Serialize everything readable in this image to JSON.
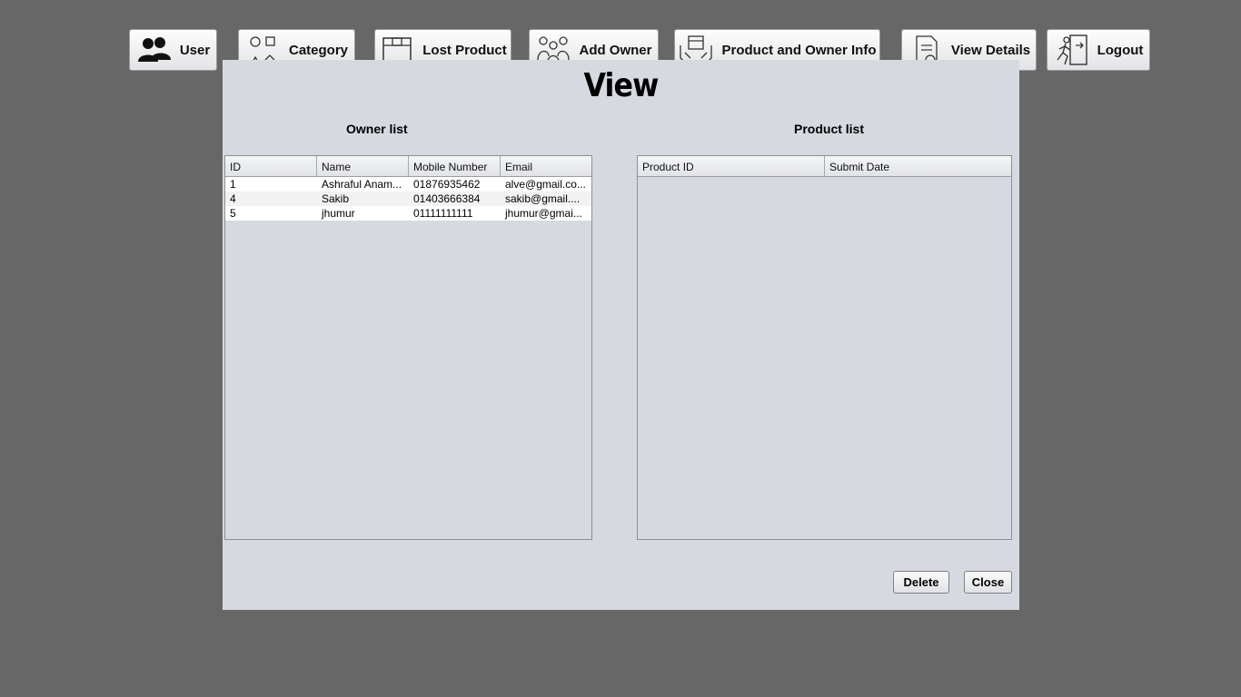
{
  "nav": [
    {
      "label": "User",
      "icon": "users-icon"
    },
    {
      "label": "Category",
      "icon": "shapes-icon"
    },
    {
      "label": "Lost Product",
      "icon": "box-icon"
    },
    {
      "label": "Add Owner",
      "icon": "people-group-icon"
    },
    {
      "label": "Product and Owner Info",
      "icon": "product-hands-icon"
    },
    {
      "label": "View Details",
      "icon": "document-view-icon"
    },
    {
      "label": "Logout",
      "icon": "exit-icon"
    }
  ],
  "panel": {
    "title": "View",
    "owner_list": {
      "title": "Owner list",
      "columns": [
        "ID",
        "Name",
        "Mobile Number",
        "Email"
      ],
      "rows": [
        [
          "1",
          "Ashraful Anam...",
          "01876935462",
          "alve@gmail.co..."
        ],
        [
          "4",
          "Sakib",
          "01403666384",
          "sakib@gmail...."
        ],
        [
          "5",
          "jhumur",
          "01111111111",
          "jhumur@gmai..."
        ]
      ]
    },
    "product_list": {
      "title": "Product list",
      "columns": [
        "Product ID",
        "Submit Date"
      ],
      "rows": []
    },
    "delete_label": "Delete",
    "close_label": "Close"
  }
}
